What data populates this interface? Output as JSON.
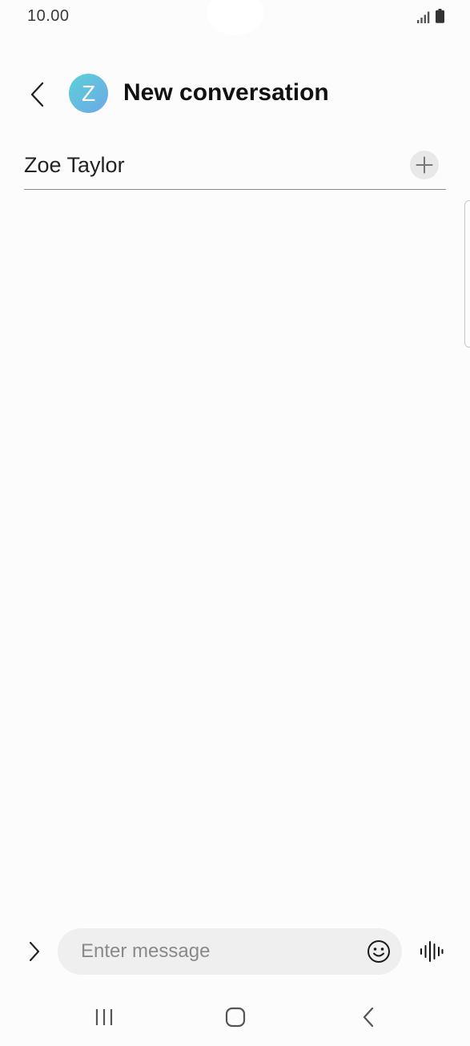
{
  "status_bar": {
    "time": "10.00",
    "icons": [
      "signal-icon",
      "battery-icon"
    ]
  },
  "header": {
    "back_icon": "chevron-left-icon",
    "avatar_letter": "Z",
    "title": "New conversation"
  },
  "recipient": {
    "value": "Zoe Taylor",
    "add_icon": "plus-icon"
  },
  "composer": {
    "expand_icon": "chevron-right-icon",
    "placeholder": "Enter message",
    "emoji_icon": "smiley-icon",
    "voice_icon": "voice-wave-icon"
  },
  "nav_bar": {
    "recents_icon": "recents-icon",
    "home_icon": "home-icon",
    "back_icon": "back-icon"
  },
  "colors": {
    "background": "#fcfcfc",
    "avatar_gradient_start": "#5bd1d7",
    "avatar_gradient_end": "#6fa7e8",
    "input_background": "#efefef"
  }
}
